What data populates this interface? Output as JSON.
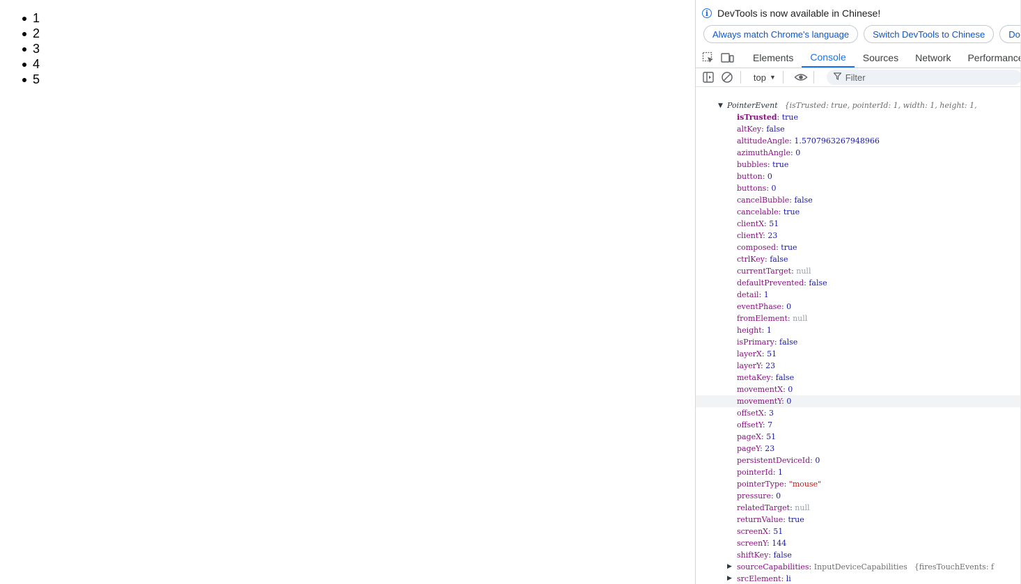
{
  "page": {
    "list_items": [
      "1",
      "2",
      "3",
      "4",
      "5"
    ]
  },
  "devtools": {
    "info_text": "DevTools is now available in Chinese!",
    "buttons": [
      "Always match Chrome's language",
      "Switch DevTools to Chinese",
      "Don't"
    ],
    "tabs": [
      "Elements",
      "Console",
      "Sources",
      "Network",
      "Performance"
    ],
    "active_tab": "Console",
    "context": "top",
    "filter_label": "Filter",
    "accent_color": "#1a73e8",
    "icons": {
      "inspect": "inspect-element-icon",
      "device": "device-toolbar-icon",
      "sidebar": "console-sidebar-icon",
      "clear": "clear-console-icon",
      "eye": "live-expression-eye-icon",
      "filter": "filter-funnel-icon"
    }
  },
  "console": {
    "object_name": "PointerEvent",
    "preview": "{isTrusted: true, pointerId: 1, width: 1, height: 1,",
    "properties": [
      {
        "key": "isTrusted",
        "value": "true",
        "type": "bool",
        "bold": true
      },
      {
        "key": "altKey",
        "value": "false",
        "type": "bool"
      },
      {
        "key": "altitudeAngle",
        "value": "1.5707963267948966",
        "type": "num"
      },
      {
        "key": "azimuthAngle",
        "value": "0",
        "type": "num"
      },
      {
        "key": "bubbles",
        "value": "true",
        "type": "bool"
      },
      {
        "key": "button",
        "value": "0",
        "type": "num"
      },
      {
        "key": "buttons",
        "value": "0",
        "type": "num"
      },
      {
        "key": "cancelBubble",
        "value": "false",
        "type": "bool"
      },
      {
        "key": "cancelable",
        "value": "true",
        "type": "bool"
      },
      {
        "key": "clientX",
        "value": "51",
        "type": "num"
      },
      {
        "key": "clientY",
        "value": "23",
        "type": "num"
      },
      {
        "key": "composed",
        "value": "true",
        "type": "bool"
      },
      {
        "key": "ctrlKey",
        "value": "false",
        "type": "bool"
      },
      {
        "key": "currentTarget",
        "value": "null",
        "type": "null"
      },
      {
        "key": "defaultPrevented",
        "value": "false",
        "type": "bool"
      },
      {
        "key": "detail",
        "value": "1",
        "type": "num"
      },
      {
        "key": "eventPhase",
        "value": "0",
        "type": "num"
      },
      {
        "key": "fromElement",
        "value": "null",
        "type": "null"
      },
      {
        "key": "height",
        "value": "1",
        "type": "num"
      },
      {
        "key": "isPrimary",
        "value": "false",
        "type": "bool"
      },
      {
        "key": "layerX",
        "value": "51",
        "type": "num"
      },
      {
        "key": "layerY",
        "value": "23",
        "type": "num"
      },
      {
        "key": "metaKey",
        "value": "false",
        "type": "bool"
      },
      {
        "key": "movementX",
        "value": "0",
        "type": "num"
      },
      {
        "key": "movementY",
        "value": "0",
        "type": "num",
        "highlight": true
      },
      {
        "key": "offsetX",
        "value": "3",
        "type": "num"
      },
      {
        "key": "offsetY",
        "value": "7",
        "type": "num"
      },
      {
        "key": "pageX",
        "value": "51",
        "type": "num"
      },
      {
        "key": "pageY",
        "value": "23",
        "type": "num"
      },
      {
        "key": "persistentDeviceId",
        "value": "0",
        "type": "num"
      },
      {
        "key": "pointerId",
        "value": "1",
        "type": "num"
      },
      {
        "key": "pointerType",
        "value": "\"mouse\"",
        "type": "str"
      },
      {
        "key": "pressure",
        "value": "0",
        "type": "num"
      },
      {
        "key": "relatedTarget",
        "value": "null",
        "type": "null"
      },
      {
        "key": "returnValue",
        "value": "true",
        "type": "bool"
      },
      {
        "key": "screenX",
        "value": "51",
        "type": "num"
      },
      {
        "key": "screenY",
        "value": "144",
        "type": "num"
      },
      {
        "key": "shiftKey",
        "value": "false",
        "type": "bool"
      },
      {
        "key": "sourceCapabilities",
        "value": "InputDeviceCapabilities",
        "type": "obj",
        "expandable": true,
        "extra": "{firesTouchEvents: f"
      },
      {
        "key": "srcElement",
        "value": "li",
        "type": "num",
        "expandable": true
      }
    ]
  }
}
